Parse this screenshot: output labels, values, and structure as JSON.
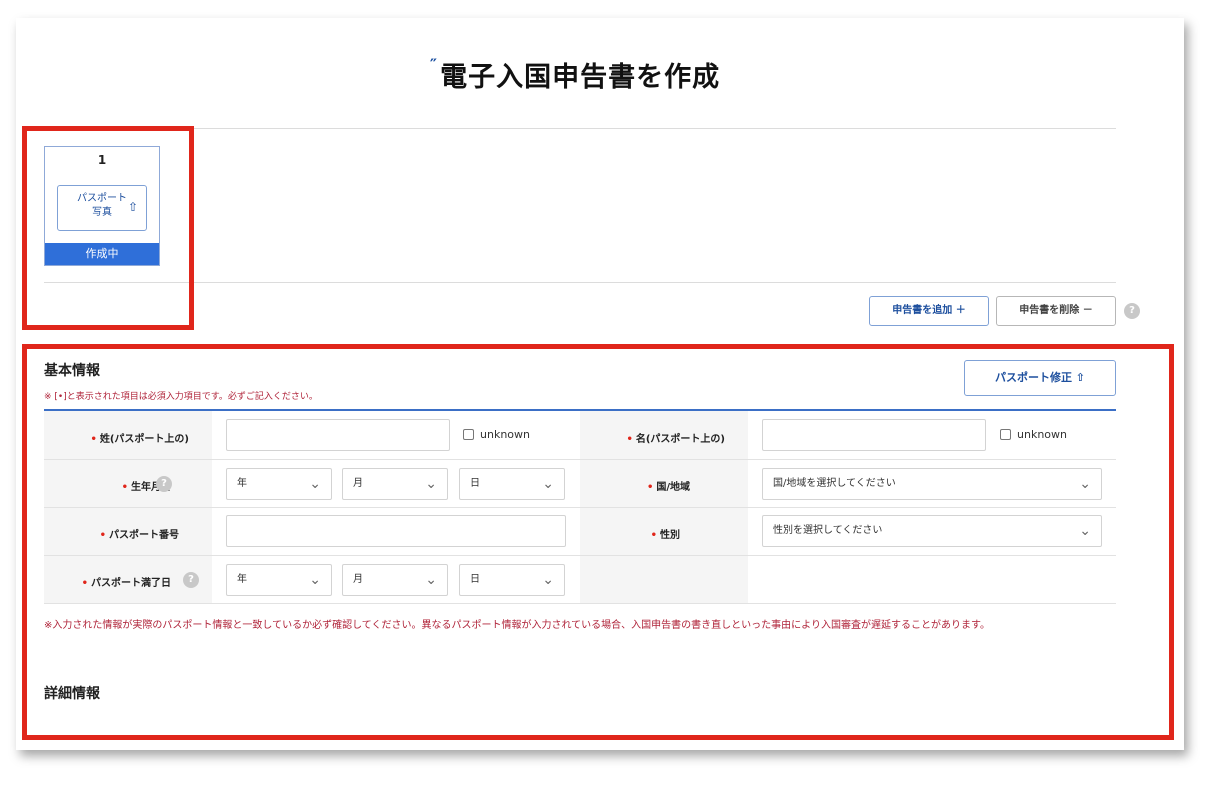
{
  "title": "電子入国申告書を作成",
  "title_mark": "″",
  "card": {
    "number": "1",
    "upload_label_line1": "パスポート",
    "upload_label_line2": "写真",
    "upload_icon": "upload-icon",
    "status": "作成中"
  },
  "actions": {
    "add_label": "申告書を追加 ＋",
    "remove_label": "申告書を削除 －",
    "help_icon": "question-icon"
  },
  "basic_info": {
    "title": "基本情報",
    "required_note": "※ [•]と表示された項目は必須入力項目です。必ずご記入ください。",
    "passport_fix_label": "パスポート修正 ⇧"
  },
  "form": {
    "required_mark": "•",
    "surname_label": "姓(パスポート上の)",
    "given_name_label": "名(パスポート上の)",
    "unknown_label": "unknown",
    "birthdate_label": "生年月日",
    "country_label": "国/地域",
    "country_placeholder": "国/地域を選択してください",
    "passport_number_label": "パスポート番号",
    "gender_label": "性別",
    "gender_placeholder": "性別を選択してください",
    "passport_expiry_label": "パスポート満了日",
    "year": "年",
    "month": "月",
    "day": "日"
  },
  "warning": "※入力された情報が実際のパスポート情報と一致しているか必ず確認してください。異なるパスポート情報が入力されている場合、入国申告書の書き直しといった事由により入国審査が遅延することがあります。",
  "detail_info": {
    "title": "詳細情報"
  },
  "colors": {
    "accent_blue": "#2f6fd9",
    "highlight_red": "#e0261b",
    "warning_text": "#b0243a"
  }
}
